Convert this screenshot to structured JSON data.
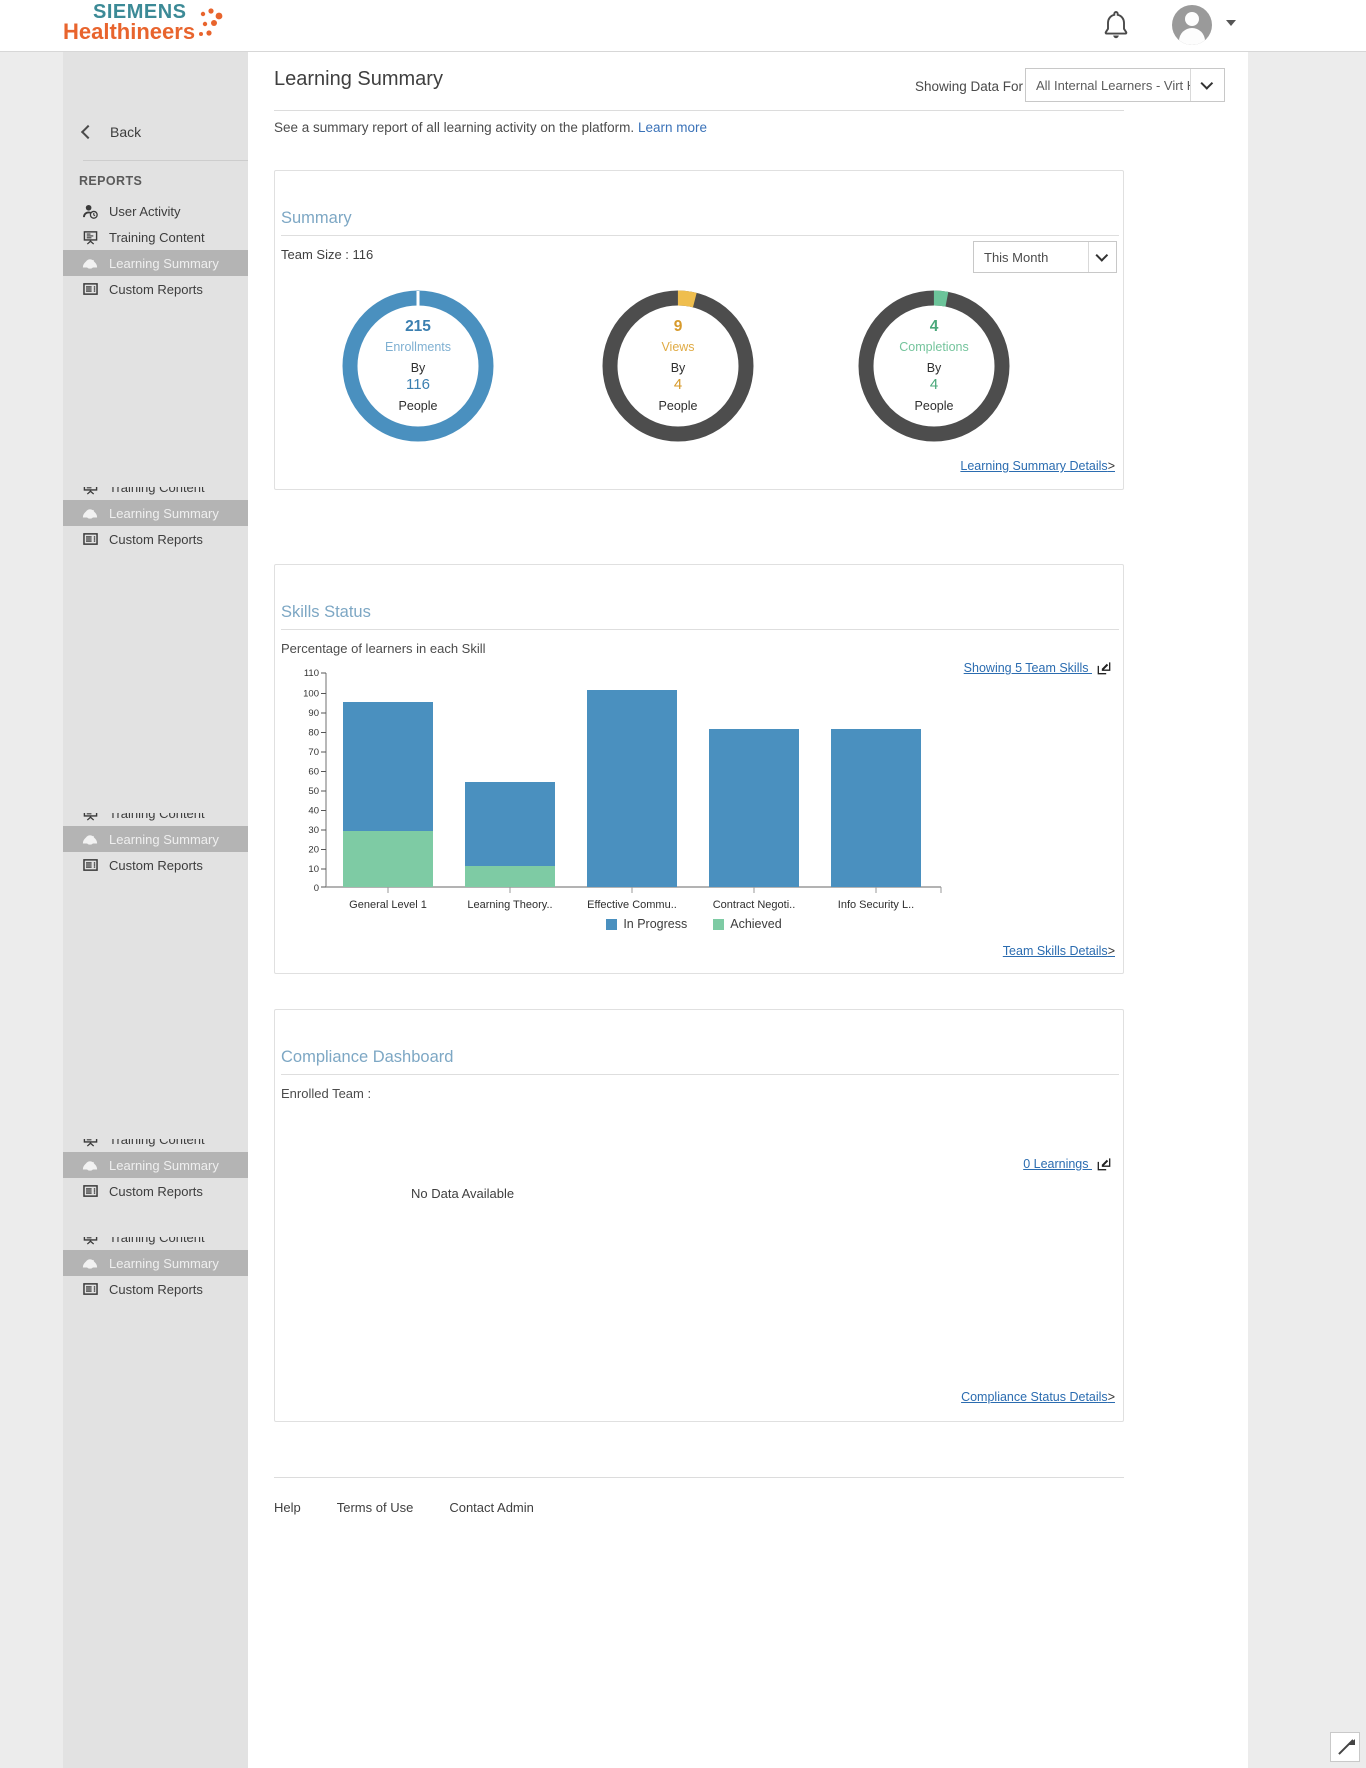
{
  "topbar": {
    "logo_line1": "SIEMENS",
    "logo_line2": "Healthineers",
    "bell_icon": "bell-icon",
    "avatar_icon": "user-avatar-icon",
    "caret_icon": "chevron-down-icon"
  },
  "sidebar": {
    "back_label": "Back",
    "section_title": "REPORTS",
    "items": [
      {
        "label": "User Activity",
        "icon": "user-clock-icon",
        "active": false
      },
      {
        "label": "Training Content",
        "icon": "presentation-board-icon",
        "active": false
      },
      {
        "label": "Learning Summary",
        "icon": "speedometer-icon",
        "active": true
      },
      {
        "label": "Custom Reports",
        "icon": "report-list-icon",
        "active": false
      }
    ]
  },
  "header": {
    "title": "Learning Summary",
    "showing_data_for_label": "Showing Data For",
    "audience_value": "All Internal Learners - Virt Hu…",
    "subtitle": "See a summary report of all learning activity on the platform.",
    "learn_more": "Learn more"
  },
  "summary_card": {
    "title": "Summary",
    "team_size": "Team Size : 116",
    "period_value": "This Month",
    "details_link": "Learning Summary Details",
    "link_arrow": ">",
    "donuts": [
      {
        "value": "215",
        "caption": "Enrollments",
        "by": "By",
        "people_count": "116",
        "people": "People",
        "color": "#4a90bf",
        "track": "#4a90bf",
        "percent": 99
      },
      {
        "value": "9",
        "caption": "Views",
        "by": "By",
        "people_count": "4",
        "people": "People",
        "color": "#efbe4e",
        "track": "#4d4d4d",
        "percent": 4
      },
      {
        "value": "4",
        "caption": "Completions",
        "by": "By",
        "people_count": "4",
        "people": "People",
        "color": "#6cc49a",
        "track": "#4d4d4d",
        "percent": 2
      }
    ]
  },
  "skills_card": {
    "title": "Skills Status",
    "subtitle": "Percentage of learners in each Skill",
    "showing_link": "Showing 5 Team Skills",
    "edit_icon": "edit-pencil-icon",
    "details_link": "Team Skills Details",
    "link_arrow": ">"
  },
  "chart_data": {
    "type": "bar",
    "title": "Skills Status",
    "subtitle": "Percentage of learners in each Skill",
    "xlabel": "",
    "ylabel": "",
    "ylim": [
      0,
      110
    ],
    "yticks": [
      0,
      10,
      20,
      30,
      40,
      50,
      60,
      70,
      80,
      90,
      100,
      110
    ],
    "grid": false,
    "stacked": true,
    "legend_position": "bottom",
    "categories": [
      "General Level 1",
      "Learning Theory..",
      "Effective Commu..",
      "Contract Negoti..",
      "Info Security L.."
    ],
    "series": [
      {
        "name": "Achieved",
        "color": "#7ecba4",
        "values": [
          29,
          11,
          0,
          0,
          0
        ]
      },
      {
        "name": "In Progress",
        "color": "#4a90bf",
        "values": [
          66,
          43,
          101,
          81,
          81
        ]
      }
    ],
    "totals": [
      95,
      54,
      101,
      81,
      81
    ]
  },
  "compliance_card": {
    "title": "Compliance Dashboard",
    "enrolled_team_label": "Enrolled Team :",
    "learnings_link": "0 Learnings",
    "edit_icon": "edit-pencil-icon",
    "no_data": "No Data Available",
    "details_link": "Compliance Status Details",
    "link_arrow": ">"
  },
  "footer": {
    "links": [
      "Help",
      "Terms of Use",
      "Contact Admin"
    ]
  }
}
